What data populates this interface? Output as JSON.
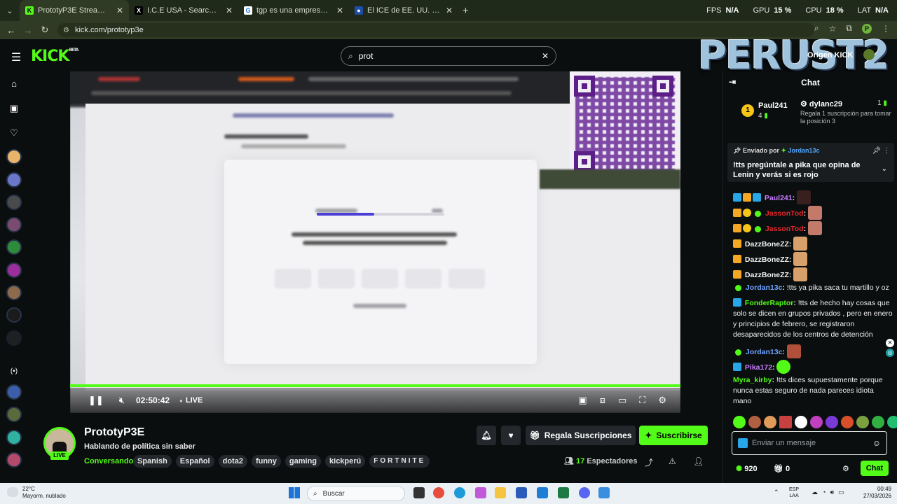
{
  "browser": {
    "tabs": [
      {
        "title": "PrototyP3E Stream - Watch Live",
        "favicon_color": "#53fc18",
        "favicon_glyph": "K",
        "active": true
      },
      {
        "title": "I.C.E USA - Search / X",
        "favicon_color": "#000000",
        "favicon_glyph": "X",
        "active": false
      },
      {
        "title": "tgp es una empresa privada o p",
        "favicon_color": "#ffffff",
        "favicon_glyph": "G",
        "active": false
      },
      {
        "title": "El ICE de EE. UU. enfrentará juic",
        "favicon_color": "#1f4ea8",
        "favicon_glyph": "●",
        "active": false
      }
    ],
    "url": "kick.com/prototyp3e",
    "perf": {
      "fps_label": "FPS",
      "fps_value": "N/A",
      "gpu_label": "GPU",
      "gpu_value": "15 %",
      "cpu_label": "CPU",
      "cpu_value": "18 %",
      "lat_label": "LAT",
      "lat_value": "N/A"
    }
  },
  "header": {
    "logo": "KICK",
    "logo_sup": "BETA",
    "search_value": "prot",
    "overlay_logo": "PERUST2",
    "overlay_badge": "Origen KICK"
  },
  "player": {
    "time": "02:50:42",
    "live_label": "LIVE",
    "progress_percent": 45
  },
  "channel": {
    "name": "PrototyP3E",
    "stream_title": "Hablando de política sin saber",
    "live_badge": "LIVE",
    "category": "Conversando",
    "tags": [
      "Spanish",
      "Español",
      "dota2",
      "funny",
      "gaming",
      "kickperú",
      "FORTNITE"
    ],
    "gift_label": "Regala Suscripciones",
    "subscribe_label": "Suscribirse",
    "viewers_count": "17",
    "viewers_label": "Espectadores"
  },
  "chat": {
    "title": "Chat",
    "leaderboard": {
      "rank": "1",
      "first_name": "Paul241",
      "first_count": "4",
      "second_name": "dylanc29",
      "second_count": "1",
      "second_desc": "Regala 1 suscripción para tomar la posición 3"
    },
    "pinned": {
      "by_label": "Enviado por",
      "user": "Jordan13c",
      "message": "!tts pregúntale a pika que opina de Lenin y verás si es rojo"
    },
    "messages": [
      {
        "user": "Paul241",
        "text": "",
        "color": "purple"
      },
      {
        "user": "JassonTod",
        "text": "",
        "color": "red"
      },
      {
        "user": "JassonTod",
        "text": "",
        "color": "red"
      },
      {
        "user": "DazzBoneZZ",
        "text": "",
        "color": "white"
      },
      {
        "user": "DazzBoneZZ",
        "text": "",
        "color": "white"
      },
      {
        "user": "DazzBoneZZ",
        "text": "",
        "color": "white"
      },
      {
        "user": "Jordan13c",
        "text": "!tts ya pika saca tu martillo y oz",
        "color": "blue"
      },
      {
        "user": "FonderRaptor",
        "text": "!tts de hecho hay cosas que solo se dicen en grupos privados , pero en enero y principios de febrero, se registraron desaparecidos de los centros de detención",
        "color": "green"
      },
      {
        "user": "Jordan13c",
        "text": "",
        "color": "blue"
      },
      {
        "user": "Pika172",
        "text": "",
        "color": "purple"
      },
      {
        "user": "Myra_kirby",
        "text": "!tts dices supuestamente porque nunca estas seguro de nada pareces idiota mano",
        "color": "white"
      }
    ],
    "input_placeholder": "Enviar un mensaje",
    "points": "920",
    "gifts": "0",
    "send_label": "Chat"
  },
  "taskbar": {
    "weather_temp": "22°C",
    "weather_desc": "Mayorm. nublado",
    "search_label": "Buscar",
    "lang_top": "ESP",
    "lang_bottom": "LAA",
    "time": "00:49",
    "date": "27/03/2026"
  }
}
